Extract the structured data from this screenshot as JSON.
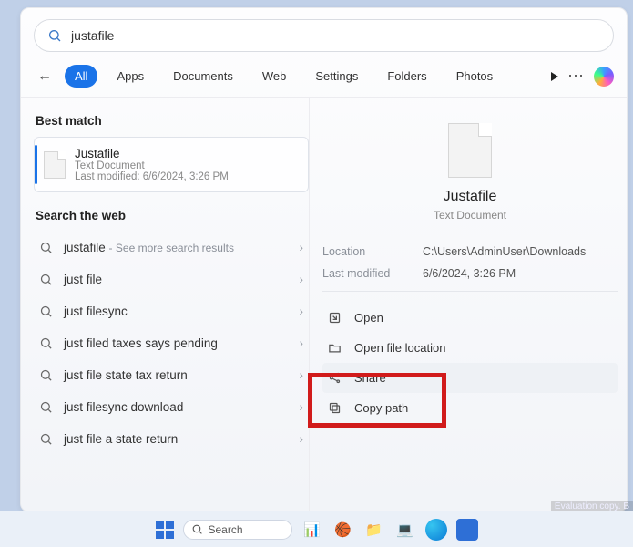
{
  "search": {
    "value": "justafile"
  },
  "filters": [
    "All",
    "Apps",
    "Documents",
    "Web",
    "Settings",
    "Folders",
    "Photos"
  ],
  "active_filter_index": 0,
  "sections": {
    "best_match": "Best match",
    "search_web": "Search the web"
  },
  "best": {
    "name": "Justafile",
    "kind": "Text Document",
    "modified": "Last modified: 6/6/2024, 3:26 PM"
  },
  "web_items": [
    {
      "term": "justafile",
      "suffix": "See more search results"
    },
    {
      "term": "just file"
    },
    {
      "term": "just filesync"
    },
    {
      "term": "just filed taxes says pending"
    },
    {
      "term": "just file state tax return"
    },
    {
      "term": "just filesync download"
    },
    {
      "term": "just file a state return"
    }
  ],
  "preview": {
    "name": "Justafile",
    "kind": "Text Document",
    "location_label": "Location",
    "location": "C:\\Users\\AdminUser\\Downloads",
    "modified_label": "Last modified",
    "modified": "6/6/2024, 3:26 PM",
    "actions": {
      "open": "Open",
      "open_location": "Open file location",
      "share": "Share",
      "copy_path": "Copy path"
    }
  },
  "taskbar": {
    "search_placeholder": "Search"
  },
  "watermark": "Evaluation copy. B"
}
